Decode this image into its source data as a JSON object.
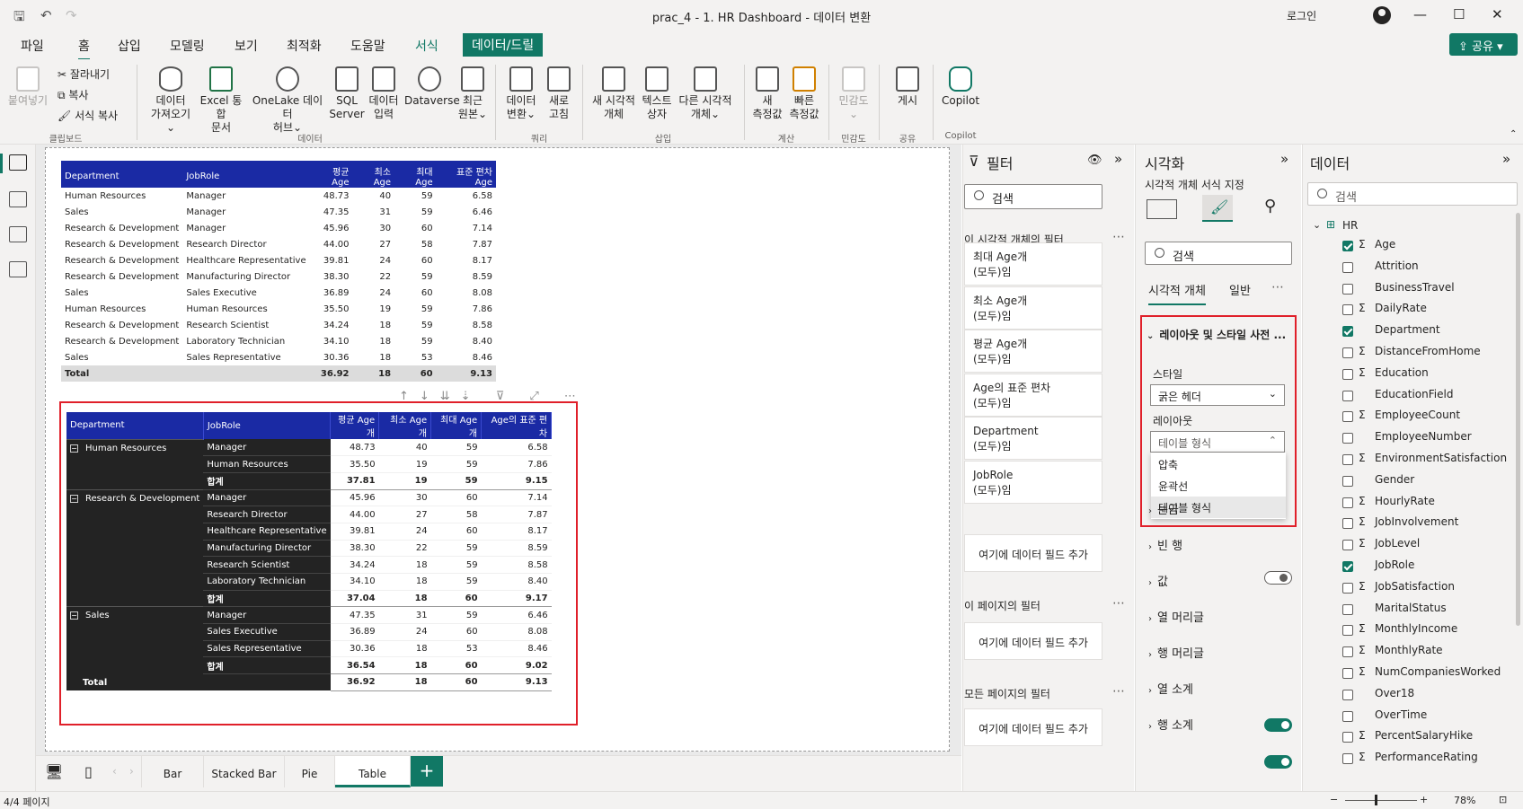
{
  "window": {
    "title": "prac_4 - 1. HR Dashboard - 데이터 변환",
    "login": "로그인"
  },
  "menu_tabs": [
    "파일",
    "홈",
    "삽입",
    "모델링",
    "보기",
    "최적화",
    "도움말",
    "서식",
    "데이터/드릴"
  ],
  "share_label": "공유",
  "ribbon": {
    "clipboard": {
      "paste": "붙여넣기",
      "cut": "잘라내기",
      "copy": "복사",
      "format_copy": "서식 복사",
      "group": "클립보드"
    },
    "data": {
      "get_data": [
        "데이터",
        "가져오기"
      ],
      "excel": [
        "Excel 통합",
        "문서"
      ],
      "onelake": [
        "OneLake 데이터",
        "허브"
      ],
      "sql": [
        "SQL",
        "Server"
      ],
      "enter": [
        "데이터",
        "입력"
      ],
      "dataverse": "Dataverse",
      "recent": [
        "최근",
        "원본"
      ],
      "group": "데이터"
    },
    "query": {
      "transform": [
        "데이터",
        "변환"
      ],
      "refresh": [
        "새로",
        "고침"
      ],
      "group": "쿼리"
    },
    "insert": {
      "new_visual": [
        "새 시각적",
        "개체"
      ],
      "textbox": [
        "텍스트",
        "상자"
      ],
      "more": [
        "다른 시각적",
        "개체"
      ],
      "group": "삽입"
    },
    "calc": {
      "new_measure": [
        "새",
        "측정값"
      ],
      "quick": [
        "빠른",
        "측정값"
      ],
      "group": "계산"
    },
    "sens": {
      "label": "민감도",
      "group": "민감도"
    },
    "share": {
      "label": "게시",
      "group": "공유"
    },
    "copilot": {
      "label": "Copilot",
      "group": "Copilot"
    }
  },
  "table1": {
    "headers": [
      "Department",
      "JobRole",
      "평균 Age",
      "최소 Age",
      "최대 Age",
      "표준 편차 Age"
    ],
    "rows": [
      [
        "Human Resources",
        "Manager",
        "48.73",
        "40",
        "59",
        "6.58"
      ],
      [
        "Sales",
        "Manager",
        "47.35",
        "31",
        "59",
        "6.46"
      ],
      [
        "Research & Development",
        "Manager",
        "45.96",
        "30",
        "60",
        "7.14"
      ],
      [
        "Research & Development",
        "Research Director",
        "44.00",
        "27",
        "58",
        "7.87"
      ],
      [
        "Research & Development",
        "Healthcare Representative",
        "39.81",
        "24",
        "60",
        "8.17"
      ],
      [
        "Research & Development",
        "Manufacturing Director",
        "38.30",
        "22",
        "59",
        "8.59"
      ],
      [
        "Sales",
        "Sales Executive",
        "36.89",
        "24",
        "60",
        "8.08"
      ],
      [
        "Human Resources",
        "Human Resources",
        "35.50",
        "19",
        "59",
        "7.86"
      ],
      [
        "Research & Development",
        "Research Scientist",
        "34.24",
        "18",
        "59",
        "8.58"
      ],
      [
        "Research & Development",
        "Laboratory Technician",
        "34.10",
        "18",
        "59",
        "8.40"
      ],
      [
        "Sales",
        "Sales Representative",
        "30.36",
        "18",
        "53",
        "8.46"
      ]
    ],
    "total": [
      "Total",
      "",
      "36.92",
      "18",
      "60",
      "9.13"
    ]
  },
  "table2": {
    "headers": [
      "Department",
      "JobRole",
      "평균 Age개",
      "최소 Age개",
      "최대 Age개",
      "Age의 표준 편차"
    ],
    "groups": [
      {
        "dept": "Human Resources",
        "rows": [
          [
            "Manager",
            "48.73",
            "40",
            "59",
            "6.58"
          ],
          [
            "Human Resources",
            "35.50",
            "19",
            "59",
            "7.86"
          ]
        ],
        "subtotal": [
          "합계",
          "37.81",
          "19",
          "59",
          "9.15"
        ]
      },
      {
        "dept": "Research & Development",
        "rows": [
          [
            "Manager",
            "45.96",
            "30",
            "60",
            "7.14"
          ],
          [
            "Research Director",
            "44.00",
            "27",
            "58",
            "7.87"
          ],
          [
            "Healthcare Representative",
            "39.81",
            "24",
            "60",
            "8.17"
          ],
          [
            "Manufacturing Director",
            "38.30",
            "22",
            "59",
            "8.59"
          ],
          [
            "Research Scientist",
            "34.24",
            "18",
            "59",
            "8.58"
          ],
          [
            "Laboratory Technician",
            "34.10",
            "18",
            "59",
            "8.40"
          ]
        ],
        "subtotal": [
          "합계",
          "37.04",
          "18",
          "60",
          "9.17"
        ]
      },
      {
        "dept": "Sales",
        "rows": [
          [
            "Manager",
            "47.35",
            "31",
            "59",
            "6.46"
          ],
          [
            "Sales Executive",
            "36.89",
            "24",
            "60",
            "8.08"
          ],
          [
            "Sales Representative",
            "30.36",
            "18",
            "53",
            "8.46"
          ]
        ],
        "subtotal": [
          "합계",
          "36.54",
          "18",
          "60",
          "9.02"
        ]
      }
    ],
    "total": [
      "Total",
      "36.92",
      "18",
      "60",
      "9.13"
    ]
  },
  "page_tabs": [
    "Bar",
    "Stacked Bar",
    "Pie",
    "Table"
  ],
  "status": {
    "page": "4/4 페이지",
    "zoom": "78%"
  },
  "filters": {
    "title": "필터",
    "search": "검색",
    "visual_filters_label": "이 시각적 개체의 필터",
    "cards": [
      [
        "최대 Age개",
        "(모두)임"
      ],
      [
        "최소 Age개",
        "(모두)임"
      ],
      [
        "평균 Age개",
        "(모두)임"
      ],
      [
        "Age의 표준 편차",
        "(모두)임"
      ],
      [
        "Department",
        "(모두)임"
      ],
      [
        "JobRole",
        "(모두)임"
      ]
    ],
    "add_field": "여기에 데이터 필드 추가",
    "page_filters_label": "이 페이지의 필터",
    "all_filters_label": "모든 페이지의 필터"
  },
  "viz": {
    "title": "시각화",
    "subtitle": "시각적 개체 서식 지정",
    "search": "검색",
    "tab_visual": "시각적 개체",
    "tab_general": "일반",
    "layout_section": "레이아웃 및 스타일 사전 ...",
    "style_label": "스타일",
    "style_value": "굵은 헤더",
    "layout_label": "레이아웃",
    "layout_value": "테이블 형식",
    "options": [
      "압축",
      "윤곽선",
      "테이블 형식"
    ],
    "sections": [
      "눈금",
      "빈 행",
      "값",
      "열 머리글",
      "행 머리글",
      "열 소계",
      "행 소계"
    ]
  },
  "data_pane": {
    "title": "데이터",
    "search": "검색",
    "table": "HR",
    "fields": [
      {
        "name": "Age",
        "sigma": true,
        "checked": true
      },
      {
        "name": "Attrition",
        "sigma": false,
        "checked": false
      },
      {
        "name": "BusinessTravel",
        "sigma": false,
        "checked": false
      },
      {
        "name": "DailyRate",
        "sigma": true,
        "checked": false
      },
      {
        "name": "Department",
        "sigma": false,
        "checked": true
      },
      {
        "name": "DistanceFromHome",
        "sigma": true,
        "checked": false
      },
      {
        "name": "Education",
        "sigma": true,
        "checked": false
      },
      {
        "name": "EducationField",
        "sigma": false,
        "checked": false
      },
      {
        "name": "EmployeeCount",
        "sigma": true,
        "checked": false
      },
      {
        "name": "EmployeeNumber",
        "sigma": false,
        "checked": false
      },
      {
        "name": "EnvironmentSatisfaction",
        "sigma": true,
        "checked": false
      },
      {
        "name": "Gender",
        "sigma": false,
        "checked": false
      },
      {
        "name": "HourlyRate",
        "sigma": true,
        "checked": false
      },
      {
        "name": "JobInvolvement",
        "sigma": true,
        "checked": false
      },
      {
        "name": "JobLevel",
        "sigma": true,
        "checked": false
      },
      {
        "name": "JobRole",
        "sigma": false,
        "checked": true
      },
      {
        "name": "JobSatisfaction",
        "sigma": true,
        "checked": false
      },
      {
        "name": "MaritalStatus",
        "sigma": false,
        "checked": false
      },
      {
        "name": "MonthlyIncome",
        "sigma": true,
        "checked": false
      },
      {
        "name": "MonthlyRate",
        "sigma": true,
        "checked": false
      },
      {
        "name": "NumCompaniesWorked",
        "sigma": true,
        "checked": false
      },
      {
        "name": "Over18",
        "sigma": false,
        "checked": false
      },
      {
        "name": "OverTime",
        "sigma": false,
        "checked": false
      },
      {
        "name": "PercentSalaryHike",
        "sigma": true,
        "checked": false
      },
      {
        "name": "PerformanceRating",
        "sigma": true,
        "checked": false
      }
    ]
  },
  "colors": {
    "accent": "#117865",
    "header_blue": "#1a2aa4",
    "highlight_red": "#e0202a"
  }
}
